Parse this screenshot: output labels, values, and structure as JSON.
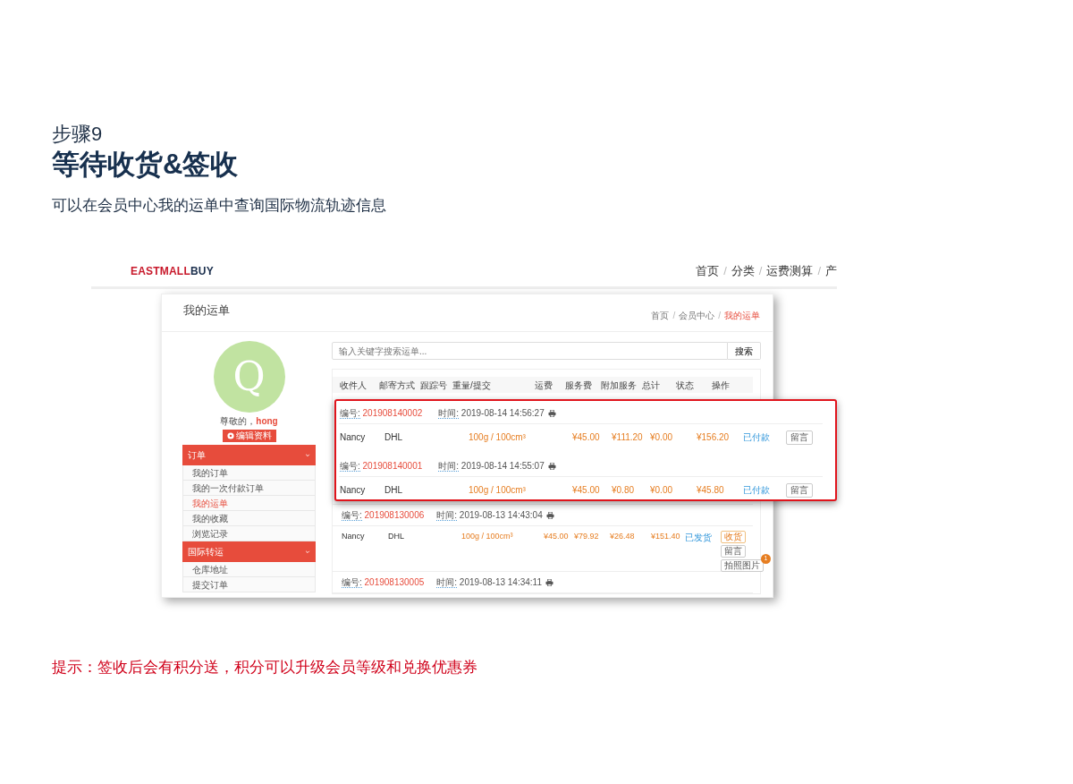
{
  "step": {
    "label": "步骤9",
    "title": "等待收货&签收",
    "description": "可以在会员中心我的运单中查询国际物流轨迹信息"
  },
  "site": {
    "logo": {
      "part1": "EASTMALL",
      "part2": "BUY"
    },
    "nav": [
      "首页",
      "分类",
      "运费测算",
      "产"
    ],
    "separator": "/"
  },
  "panel": {
    "title": "我的运单",
    "separator": "/",
    "breadcrumb": [
      {
        "label": "首页",
        "selected": false
      },
      {
        "label": "会员中心",
        "selected": false
      },
      {
        "label": "我的运单",
        "selected": true
      }
    ]
  },
  "profile": {
    "avatar_letter": "Q",
    "greeting": "尊敬的，",
    "username": "hong",
    "edit_button": "编辑资料"
  },
  "menu": [
    {
      "label": "订单",
      "expanded": true,
      "items": [
        {
          "label": "我的订单",
          "selected": false
        },
        {
          "label": "我的一次付款订单",
          "selected": false
        },
        {
          "label": "我的运单",
          "selected": true
        },
        {
          "label": "我的收藏",
          "selected": false
        },
        {
          "label": "浏览记录",
          "selected": false
        }
      ]
    },
    {
      "label": "国际转运",
      "expanded": true,
      "items": [
        {
          "label": "仓库地址",
          "selected": false
        },
        {
          "label": "提交订单",
          "selected": false
        }
      ]
    }
  ],
  "search": {
    "placeholder": "输入关键字搜索运单...",
    "button": "搜索"
  },
  "table": {
    "columns": [
      "收件人",
      "邮寄方式",
      "跟踪号",
      "重量/提交",
      "运费",
      "服务费",
      "附加服务",
      "总计",
      "状态",
      "操作"
    ],
    "orders": [
      {
        "number_label": "编号:",
        "number": "201908130006",
        "time_label": "时间:",
        "time": "2019-08-13 14:43:04",
        "recipient": "Nancy",
        "method": "DHL",
        "weight": "100g / 100cm³",
        "freight": "¥45.00",
        "service": "¥79.92",
        "extra": "¥26.48",
        "total": "¥151.40",
        "status": "已发货",
        "actions": [
          {
            "label": "收货",
            "kind": "primary"
          },
          {
            "label": "留言",
            "kind": "plain"
          },
          {
            "label": "拍照图片",
            "kind": "plain",
            "badge": "1"
          }
        ]
      },
      {
        "number_label": "编号:",
        "number": "201908130005",
        "time_label": "时间:",
        "time": "2019-08-13 14:34:11"
      }
    ]
  },
  "highlight": {
    "orders": [
      {
        "number_label": "编号:",
        "number": "201908140002",
        "time_label": "时间:",
        "time": "2019-08-14 14:56:27",
        "recipient": "Nancy",
        "method": "DHL",
        "weight": "100g / 100cm³",
        "freight": "¥45.00",
        "service": "¥111.20",
        "extra": "¥0.00",
        "total": "¥156.20",
        "status": "已付款",
        "actions": [
          {
            "label": "留言",
            "kind": "plain"
          }
        ]
      },
      {
        "number_label": "编号:",
        "number": "201908140001",
        "time_label": "时间:",
        "time": "2019-08-14 14:55:07",
        "recipient": "Nancy",
        "method": "DHL",
        "weight": "100g / 100cm³",
        "freight": "¥45.00",
        "service": "¥0.80",
        "extra": "¥0.00",
        "total": "¥45.80",
        "status": "已付款",
        "actions": [
          {
            "label": "留言",
            "kind": "plain"
          }
        ]
      }
    ]
  },
  "hint": "提示：签收后会有积分送，积分可以升级会员等级和兑换优惠券"
}
